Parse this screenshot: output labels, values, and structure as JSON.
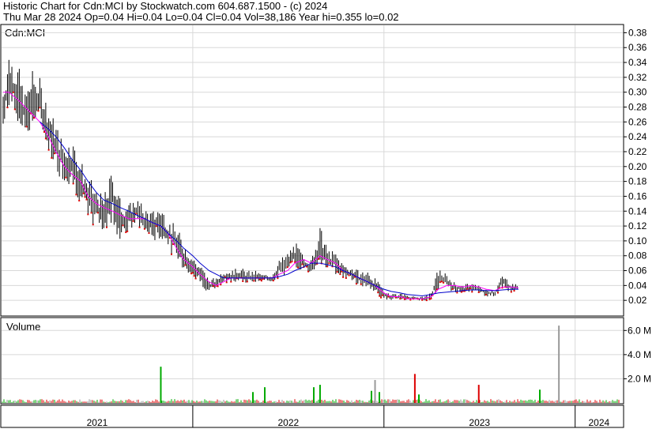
{
  "header": {
    "line1": "Historic Chart for Cdn:MCI by Stockwatch.com 604.687.1500 - (c) 2024",
    "line2": "Thu Mar 28 2024  Op=0.04  Hi=0.04  Lo=0.04  Cl=0.04  Vol=38,186  Year hi=0.355  lo=0.02"
  },
  "price_panel": {
    "label": "Cdn:MCI"
  },
  "volume_panel": {
    "label": "Volume"
  },
  "chart_data": {
    "type": "line",
    "symbol": "Cdn:MCI",
    "x_axis": {
      "labels": [
        "2021",
        "2022",
        "2023",
        "2024"
      ],
      "start": "2021-01",
      "end": "2024-03"
    },
    "price_axis": {
      "ylim": [
        0,
        0.39
      ],
      "ticks": [
        0.02,
        0.04,
        0.06,
        0.08,
        0.1,
        0.12,
        0.14,
        0.16,
        0.18,
        0.2,
        0.22,
        0.24,
        0.26,
        0.28,
        0.3,
        0.32,
        0.34,
        0.36,
        0.38
      ],
      "tick_labels": [
        "0.02",
        "0.04",
        "0.06",
        "0.08",
        "0.10",
        "0.12",
        "0.14",
        "0.16",
        "0.18",
        "0.20",
        "0.22",
        "0.24",
        "0.26",
        "0.28",
        "0.30",
        "0.32",
        "0.34",
        "0.36",
        "0.38"
      ]
    },
    "volume_axis": {
      "ylim": [
        0,
        7000000
      ],
      "ticks": [
        2000000,
        4000000,
        6000000
      ],
      "tick_labels": [
        "2.0 M",
        "4.0 M",
        "6.0 M"
      ]
    },
    "price_series": {
      "name": "",
      "x": [
        "2021-01-04",
        "2021-01-15",
        "2021-02-01",
        "2021-02-15",
        "2021-03-01",
        "2021-03-15",
        "2021-04-01",
        "2021-04-15",
        "2021-05-01",
        "2021-05-15",
        "2021-06-01",
        "2021-06-15",
        "2021-07-01",
        "2021-07-15",
        "2021-08-01",
        "2021-08-15",
        "2021-09-01",
        "2021-09-15",
        "2021-10-01",
        "2021-10-15",
        "2021-11-01",
        "2021-11-15",
        "2021-12-01",
        "2021-12-15",
        "2022-01-01",
        "2022-01-15",
        "2022-02-01",
        "2022-02-15",
        "2022-03-01",
        "2022-03-15",
        "2022-04-01",
        "2022-04-15",
        "2022-05-01",
        "2022-05-15",
        "2022-06-01",
        "2022-06-15",
        "2022-07-01",
        "2022-07-15",
        "2022-08-01",
        "2022-08-15",
        "2022-09-01",
        "2022-09-15",
        "2022-10-01",
        "2022-10-15",
        "2022-11-01",
        "2022-11-15",
        "2022-12-01",
        "2022-12-15",
        "2023-01-01",
        "2023-01-15",
        "2023-02-01",
        "2023-02-15",
        "2023-03-01",
        "2023-03-15",
        "2023-04-01",
        "2023-04-15",
        "2023-05-01",
        "2023-05-15",
        "2023-06-01",
        "2023-06-15",
        "2023-07-01",
        "2023-07-15",
        "2023-08-01",
        "2023-08-15",
        "2023-09-01",
        "2023-09-15",
        "2023-10-01",
        "2023-10-15",
        "2023-11-01",
        "2023-11-15",
        "2023-12-01",
        "2023-12-15",
        "2024-01-01",
        "2024-01-15",
        "2024-02-01",
        "2024-02-15",
        "2024-03-01",
        "2024-03-15",
        "2024-03-28"
      ],
      "high": [
        0.31,
        0.355,
        0.34,
        0.3,
        0.33,
        0.32,
        0.28,
        0.26,
        0.23,
        0.24,
        0.21,
        0.19,
        0.17,
        0.16,
        0.2,
        0.16,
        0.15,
        0.16,
        0.145,
        0.14,
        0.15,
        0.13,
        0.12,
        0.1,
        0.08,
        0.07,
        0.05,
        0.05,
        0.065,
        0.06,
        0.065,
        0.06,
        0.06,
        0.055,
        0.055,
        0.075,
        0.085,
        0.1,
        0.08,
        0.075,
        0.12,
        0.09,
        0.085,
        0.07,
        0.065,
        0.06,
        0.06,
        0.05,
        0.035,
        0.03,
        0.03,
        0.028,
        0.025,
        0.025,
        0.03,
        0.065,
        0.055,
        0.045,
        0.04,
        0.045,
        0.04,
        0.035,
        0.035,
        0.055,
        0.045,
        0.04
      ],
      "low": [
        0.24,
        0.28,
        0.25,
        0.24,
        0.25,
        0.25,
        0.22,
        0.19,
        0.18,
        0.17,
        0.15,
        0.12,
        0.12,
        0.11,
        0.12,
        0.1,
        0.11,
        0.12,
        0.11,
        0.1,
        0.1,
        0.09,
        0.07,
        0.06,
        0.05,
        0.04,
        0.03,
        0.035,
        0.04,
        0.045,
        0.045,
        0.04,
        0.045,
        0.045,
        0.045,
        0.05,
        0.055,
        0.06,
        0.06,
        0.055,
        0.07,
        0.06,
        0.055,
        0.05,
        0.045,
        0.04,
        0.035,
        0.03,
        0.02,
        0.02,
        0.02,
        0.02,
        0.02,
        0.02,
        0.02,
        0.035,
        0.035,
        0.03,
        0.03,
        0.03,
        0.03,
        0.025,
        0.025,
        0.035,
        0.03,
        0.035
      ],
      "ma_short": [
        0.3,
        0.3,
        0.29,
        0.28,
        0.27,
        0.26,
        0.24,
        0.22,
        0.2,
        0.19,
        0.18,
        0.16,
        0.15,
        0.145,
        0.14,
        0.135,
        0.13,
        0.13,
        0.13,
        0.125,
        0.12,
        0.11,
        0.09,
        0.075,
        0.065,
        0.055,
        0.045,
        0.04,
        0.045,
        0.05,
        0.05,
        0.05,
        0.05,
        0.05,
        0.05,
        0.055,
        0.06,
        0.07,
        0.075,
        0.07,
        0.08,
        0.075,
        0.07,
        0.06,
        0.055,
        0.05,
        0.045,
        0.04,
        0.03,
        0.025,
        0.025,
        0.022,
        0.022,
        0.022,
        0.025,
        0.035,
        0.04,
        0.04,
        0.038,
        0.04,
        0.038,
        0.035,
        0.033,
        0.038,
        0.038,
        0.037
      ],
      "ma_long": [
        null,
        null,
        null,
        null,
        null,
        0.26,
        0.25,
        0.24,
        0.225,
        0.21,
        0.195,
        0.18,
        0.165,
        0.155,
        0.15,
        0.145,
        0.14,
        0.135,
        0.13,
        0.125,
        0.12,
        0.11,
        0.1,
        0.09,
        0.08,
        0.07,
        0.06,
        0.055,
        0.05,
        0.05,
        0.05,
        0.05,
        0.05,
        0.05,
        0.05,
        0.052,
        0.055,
        0.06,
        0.065,
        0.07,
        0.07,
        0.068,
        0.065,
        0.06,
        0.055,
        0.05,
        0.045,
        0.04,
        0.035,
        0.032,
        0.03,
        0.028,
        0.027,
        0.026,
        0.028,
        0.03,
        0.031,
        0.032,
        0.033,
        0.034,
        0.034,
        0.033,
        0.033,
        0.034,
        0.035,
        0.035
      ]
    },
    "volume_series": {
      "name": "Volume",
      "spikes": [
        {
          "date": "2021-11-01",
          "value": 3000000,
          "color": "#00aa00"
        },
        {
          "date": "2022-09-01",
          "value": 1500000,
          "color": "#00aa00"
        },
        {
          "date": "2022-12-15",
          "value": 1900000,
          "color": "#999999"
        },
        {
          "date": "2023-03-01",
          "value": 2400000,
          "color": "#dd0000"
        },
        {
          "date": "2023-07-01",
          "value": 1500000,
          "color": "#dd0000"
        },
        {
          "date": "2023-12-01",
          "value": 6400000,
          "color": "#999999"
        }
      ]
    },
    "colors": {
      "price_bar": "#000000",
      "down_mark": "#dd0000",
      "ma_short": "#ff00ff",
      "ma_long": "#0000cc",
      "vol_up": "#00aa00",
      "vol_down": "#dd0000",
      "vol_flat": "#999999"
    },
    "grid": true
  }
}
